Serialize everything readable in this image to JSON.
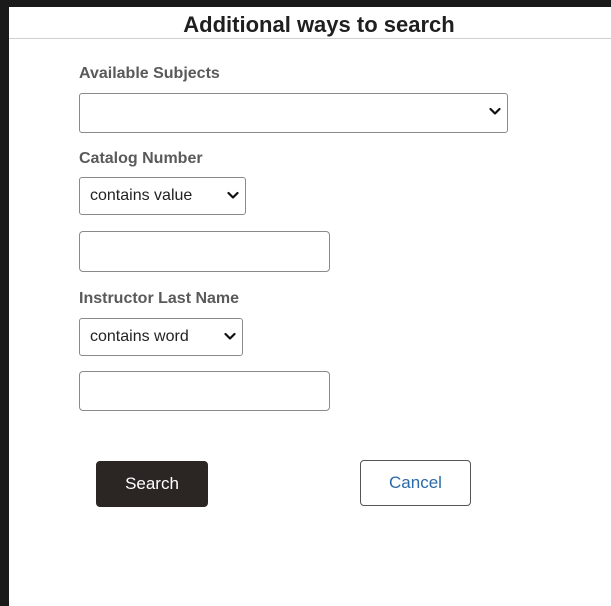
{
  "dialog": {
    "title": "Additional ways to search"
  },
  "fields": {
    "subjects": {
      "label": "Available Subjects",
      "selected": ""
    },
    "catalog_number": {
      "label": "Catalog Number",
      "operator": "contains value",
      "value": ""
    },
    "instructor_last_name": {
      "label": "Instructor Last Name",
      "operator": "contains word",
      "value": ""
    }
  },
  "actions": {
    "search_label": "Search",
    "cancel_label": "Cancel"
  },
  "icons": {
    "dropdown": "chevron-down-icon"
  }
}
